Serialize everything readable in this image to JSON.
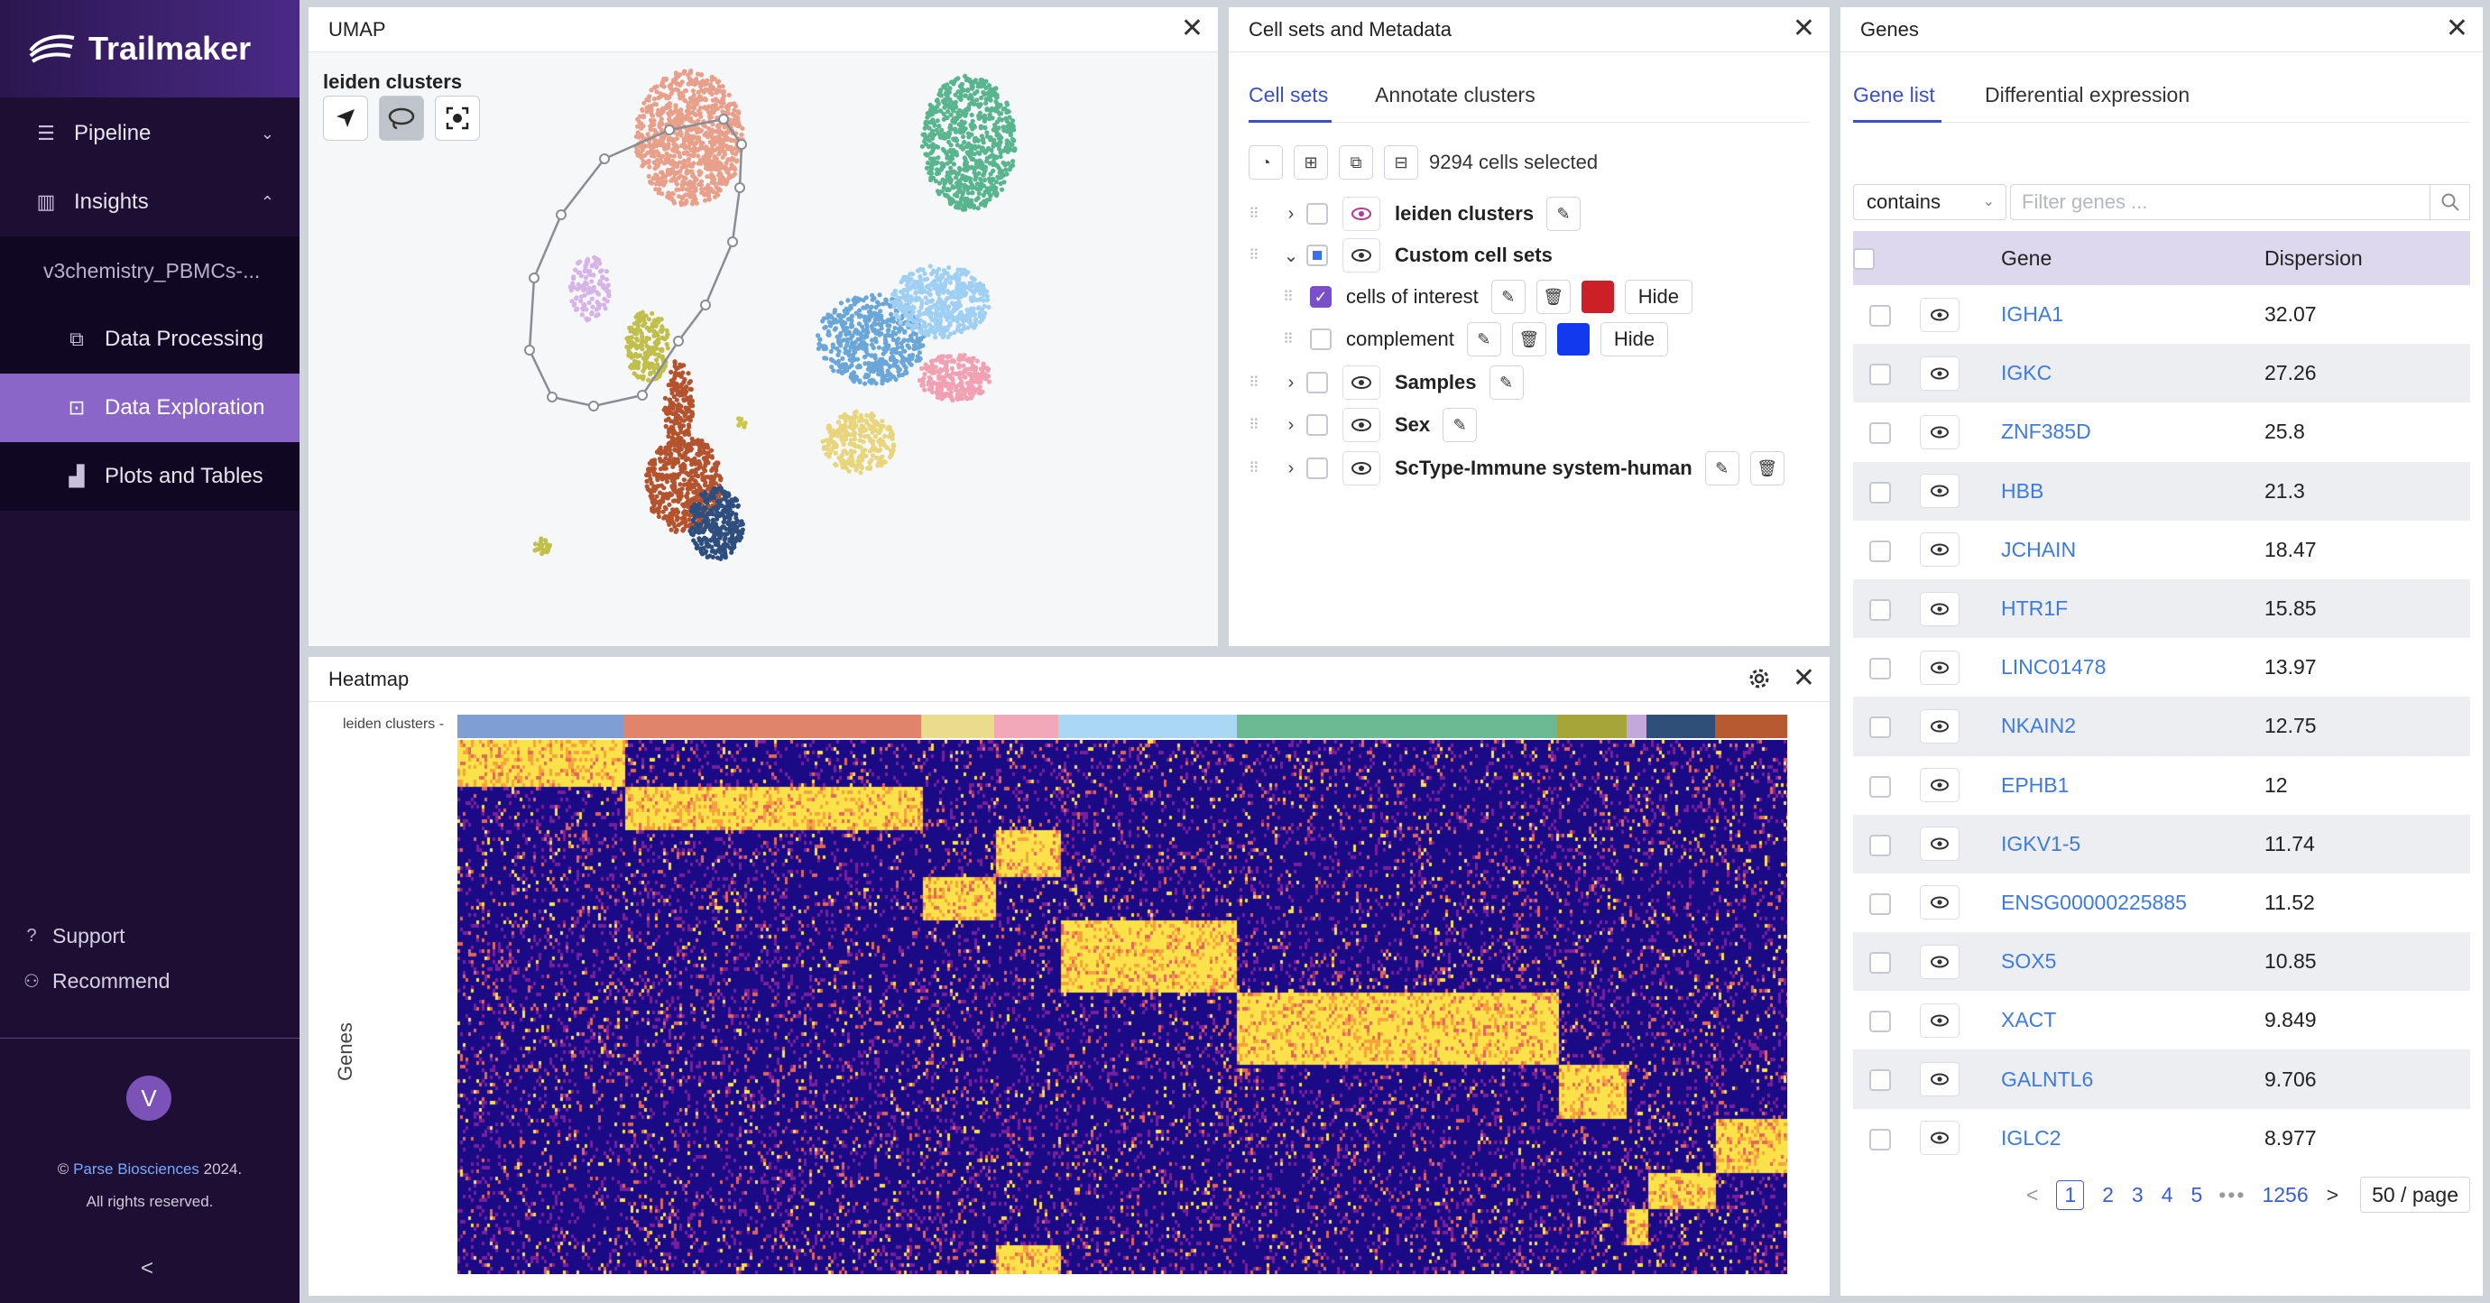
{
  "app": {
    "name": "Trailmaker"
  },
  "sidebar": {
    "pipeline": "Pipeline",
    "insights": "Insights",
    "project": "v3chemistry_PBMCs-...",
    "items": [
      "Data Processing",
      "Data Exploration",
      "Plots and Tables"
    ],
    "support": "Support",
    "recommend": "Recommend",
    "avatar": "V",
    "copyright_prefix": "©",
    "copyright_link": "Parse Biosciences",
    "copyright_year": "2024.",
    "rights": "All rights reserved.",
    "collapse": "<"
  },
  "umap": {
    "title": "UMAP",
    "label": "leiden clusters",
    "clusters": [
      {
        "color": "#e8a08a"
      },
      {
        "color": "#d7b4e6"
      },
      {
        "color": "#bfbf4a"
      },
      {
        "color": "#b5532e"
      },
      {
        "color": "#2e4f7e"
      },
      {
        "color": "#6aa6d8"
      },
      {
        "color": "#9fd0f3"
      },
      {
        "color": "#58b58e"
      },
      {
        "color": "#f1a1b2"
      },
      {
        "color": "#e8d57c"
      },
      {
        "color": "#c8c84a"
      }
    ]
  },
  "cellsets": {
    "title": "Cell sets and Metadata",
    "tabs": [
      "Cell sets",
      "Annotate clusters"
    ],
    "selected_text": "9294 cells selected",
    "rows": [
      {
        "label": "leiden clusters"
      },
      {
        "label": "Custom cell sets"
      },
      {
        "label": "cells of interest",
        "swatch": "#cc1f27",
        "hide": "Hide"
      },
      {
        "label": "complement",
        "swatch": "#1239ee",
        "hide": "Hide"
      },
      {
        "label": "Samples"
      },
      {
        "label": "Sex"
      },
      {
        "label": "ScType-Immune system-human"
      }
    ]
  },
  "heatmap": {
    "title": "Heatmap",
    "track_label": "leiden clusters -",
    "y_label": "Genes",
    "track_colors": [
      "#7f9fd3",
      "#e0856b",
      "#ebdb8c",
      "#f2a8b8",
      "#a9d6f2",
      "#6cba93",
      "#a6a53a",
      "#c3a8dc",
      "#2f4f78",
      "#b65a32"
    ],
    "track_widths": [
      0.125,
      0.224,
      0.055,
      0.048,
      0.134,
      0.241,
      0.052,
      0.015,
      0.052,
      0.054
    ]
  },
  "genes": {
    "title": "Genes",
    "tabs": [
      "Gene list",
      "Differential expression"
    ],
    "filter_mode": "contains",
    "filter_placeholder": "Filter genes ...",
    "col_gene": "Gene",
    "col_disp": "Dispersion",
    "rows": [
      {
        "gene": "IGHA1",
        "disp": "32.07"
      },
      {
        "gene": "IGKC",
        "disp": "27.26"
      },
      {
        "gene": "ZNF385D",
        "disp": "25.8"
      },
      {
        "gene": "HBB",
        "disp": "21.3"
      },
      {
        "gene": "JCHAIN",
        "disp": "18.47"
      },
      {
        "gene": "HTR1F",
        "disp": "15.85"
      },
      {
        "gene": "LINC01478",
        "disp": "13.97"
      },
      {
        "gene": "NKAIN2",
        "disp": "12.75"
      },
      {
        "gene": "EPHB1",
        "disp": "12"
      },
      {
        "gene": "IGKV1-5",
        "disp": "11.74"
      },
      {
        "gene": "ENSG00000225885",
        "disp": "11.52"
      },
      {
        "gene": "SOX5",
        "disp": "10.85"
      },
      {
        "gene": "XACT",
        "disp": "9.849"
      },
      {
        "gene": "GALNTL6",
        "disp": "9.706"
      },
      {
        "gene": "IGLC2",
        "disp": "8.977"
      }
    ],
    "pager": {
      "prev": "<",
      "pages": [
        "1",
        "2",
        "3",
        "4",
        "5"
      ],
      "ellipsis": "•••",
      "last": "1256",
      "next": ">",
      "size": "50 / page"
    }
  }
}
